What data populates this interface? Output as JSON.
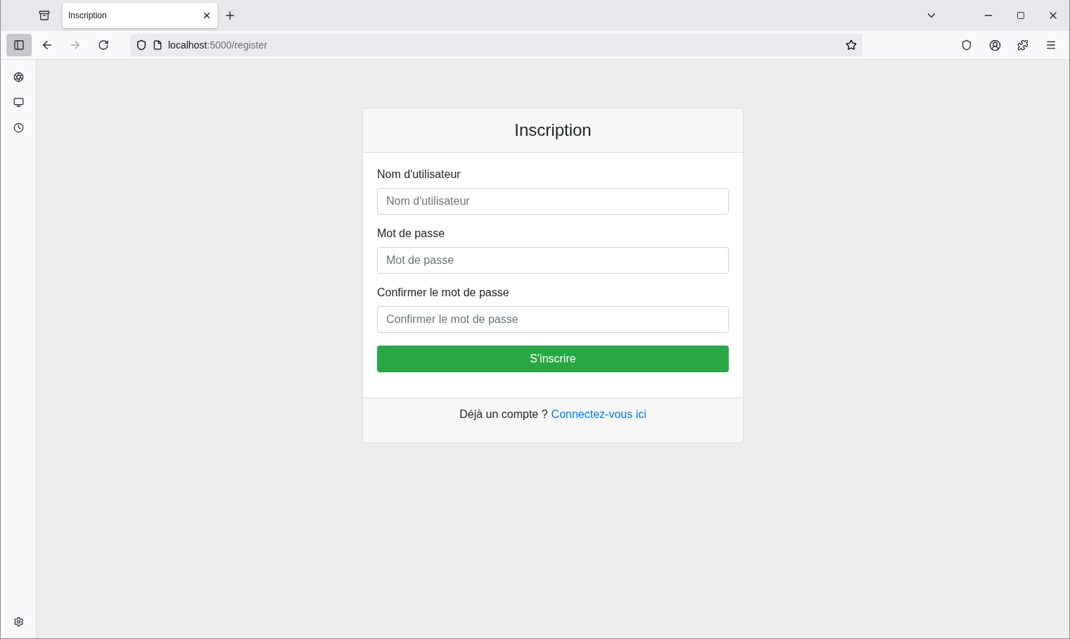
{
  "tabs": [
    {
      "title": "Inscription",
      "selected": true
    }
  ],
  "address_bar": {
    "host": "localhost",
    "path": ":5000/register"
  },
  "card": {
    "title": "Inscription",
    "fields": [
      {
        "label": "Nom d'utilisateur",
        "placeholder": "Nom d'utilisateur"
      },
      {
        "label": "Mot de passe",
        "placeholder": "Mot de passe"
      },
      {
        "label": "Confirmer le mot de passe",
        "placeholder": "Confirmer le mot de passe"
      }
    ],
    "submit": "S'inscrire",
    "footer": {
      "text": "Déjà un compte ?",
      "link": "Connectez-vous ici"
    }
  }
}
